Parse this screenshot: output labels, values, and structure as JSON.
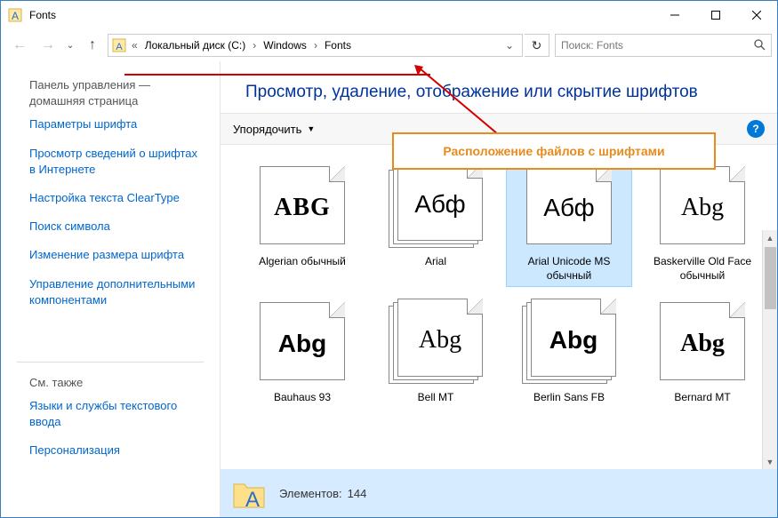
{
  "window": {
    "title": "Fonts"
  },
  "breadcrumb": {
    "drive": "Локальный диск (C:)",
    "folder1": "Windows",
    "folder2": "Fonts"
  },
  "search": {
    "placeholder": "Поиск: Fonts"
  },
  "sidebar": {
    "header": "Панель управления — домашняя страница",
    "links": [
      "Параметры шрифта",
      "Просмотр сведений о шрифтах в Интернете",
      "Настройка текста ClearType",
      "Поиск символа",
      "Изменение размера шрифта",
      "Управление дополнительными компонентами"
    ],
    "seealso_header": "См. также",
    "seealso": [
      "Языки и службы текстового ввода",
      "Персонализация"
    ]
  },
  "main": {
    "heading": "Просмотр, удаление, отображение или скрытие шрифтов",
    "organize": "Упорядочить"
  },
  "callout": "Расположение файлов с шрифтами",
  "fonts": [
    {
      "sample": "ABG",
      "label": "Algerian обычный",
      "cls": "algerian",
      "stack": false
    },
    {
      "sample": "Абф",
      "label": "Arial",
      "cls": "arial",
      "stack": true
    },
    {
      "sample": "Абф",
      "label": "Arial Unicode MS обычный",
      "cls": "arial",
      "stack": false,
      "selected": true
    },
    {
      "sample": "Abg",
      "label": "Baskerville Old Face обычный",
      "cls": "baskerville",
      "stack": false
    },
    {
      "sample": "Abg",
      "label": "Bauhaus 93",
      "cls": "bauhaus",
      "stack": false
    },
    {
      "sample": "Abg",
      "label": "Bell MT",
      "cls": "bell",
      "stack": true
    },
    {
      "sample": "Abg",
      "label": "Berlin Sans FB",
      "cls": "berlin",
      "stack": true
    },
    {
      "sample": "Abg",
      "label": "Bernard MT",
      "cls": "bernard",
      "stack": false
    }
  ],
  "status": {
    "count_label": "Элементов:",
    "count": "144"
  }
}
